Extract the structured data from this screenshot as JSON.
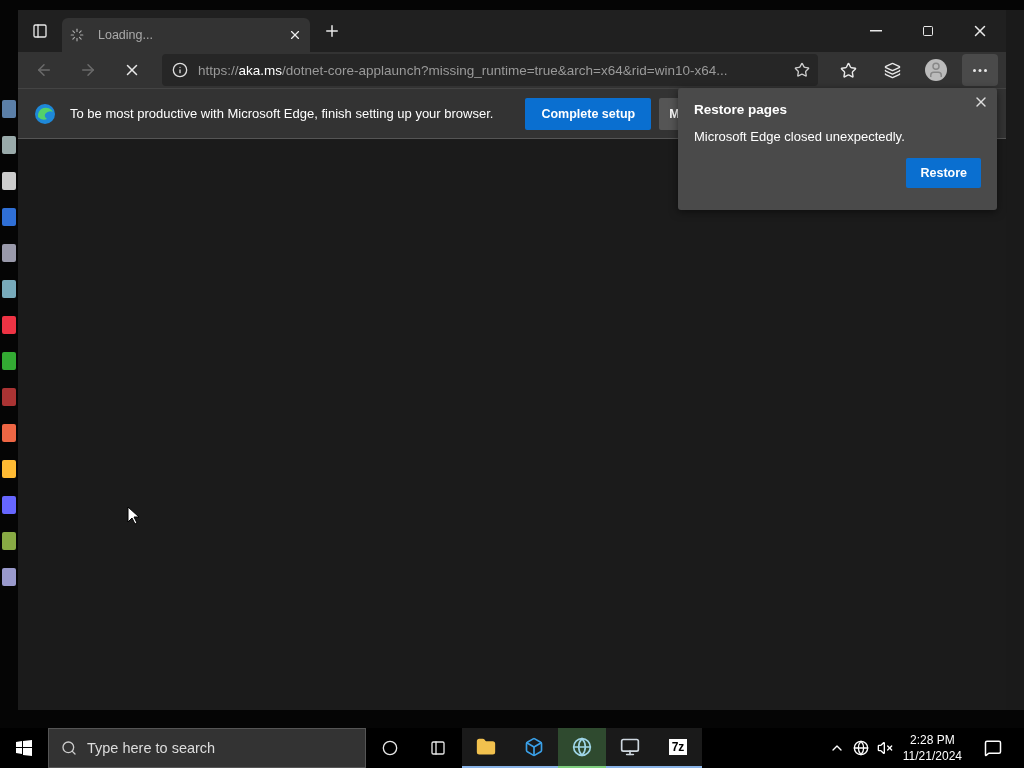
{
  "tabs": [
    {
      "title": "Loading...",
      "selected": true,
      "loading": true
    }
  ],
  "address_bar": {
    "scheme": "https://",
    "host": "aka.ms",
    "path": "/dotnet-core-applaunch?missing_runtime=true&arch=x64&rid=win10-x64..."
  },
  "infobar": {
    "message": "To be most productive with Microsoft Edge, finish setting up your browser.",
    "buttons": [
      {
        "label": "Complete setup",
        "kind": "primary"
      },
      {
        "label": "M",
        "kind": "secondary"
      }
    ]
  },
  "restore_popup": {
    "title": "Restore pages",
    "message": "Microsoft Edge closed unexpectedly.",
    "button": "Restore"
  },
  "taskbar": {
    "search": {
      "placeholder": "Type here to search"
    },
    "apps": [
      {
        "kind": "folder",
        "selected": false
      },
      {
        "kind": "box",
        "selected": false
      },
      {
        "kind": "globe",
        "selected": true
      },
      {
        "kind": "computer",
        "selected": false
      },
      {
        "kind": "archive",
        "label": "7z",
        "selected": false
      }
    ],
    "clock": {
      "time": "2:28 PM",
      "date": "11/21/2024"
    }
  }
}
